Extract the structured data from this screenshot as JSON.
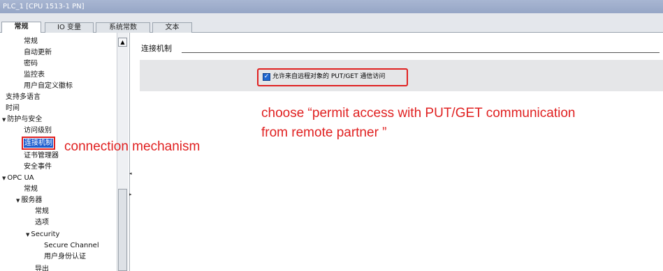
{
  "window": {
    "title": "PLC_1 [CPU 1513-1 PN]"
  },
  "tabs": [
    {
      "label": "常规",
      "active": true
    },
    {
      "label": "IO 变量",
      "active": false
    },
    {
      "label": "系统常数",
      "active": false
    },
    {
      "label": "文本",
      "active": false
    }
  ],
  "nav": {
    "items": [
      {
        "label": "常规"
      },
      {
        "label": "自动更新"
      },
      {
        "label": "密码"
      },
      {
        "label": "监控表"
      },
      {
        "label": "用户自定义徽标"
      },
      {
        "label": "支持多语言"
      },
      {
        "label": "时间"
      },
      {
        "label": "防护与安全",
        "expanded": true
      },
      {
        "label": "访问级别"
      },
      {
        "label": "连接机制",
        "selected": true
      },
      {
        "label": "证书管理器"
      },
      {
        "label": "安全事件"
      },
      {
        "label": "OPC UA",
        "expanded": true
      },
      {
        "label": "常规"
      },
      {
        "label": "服务器",
        "expanded": true
      },
      {
        "label": "常规"
      },
      {
        "label": "选项"
      },
      {
        "label": "Security",
        "expanded": true
      },
      {
        "label": "Secure Channel"
      },
      {
        "label": "用户身份认证"
      },
      {
        "label": "导出"
      }
    ]
  },
  "content": {
    "section_title": "连接机制",
    "checkbox": {
      "label": "允许来自远程对象的 PUT/GET 通信访问",
      "checked": true
    }
  },
  "annotations": {
    "mechanism": "connection mechanism",
    "choose_line1": "choose “permit access with PUT/GET communication",
    "choose_line2": "from remote partner ”"
  },
  "colors": {
    "title_bar": "#a8b6d2",
    "selection": "#1f5fd0",
    "annotation_red": "#e02020",
    "option_band": "#e5e6e8"
  },
  "icons": {
    "expand": "triangle-down-icon",
    "scroll_up": "chevron-up-icon",
    "checkbox": "checkmark-icon"
  }
}
